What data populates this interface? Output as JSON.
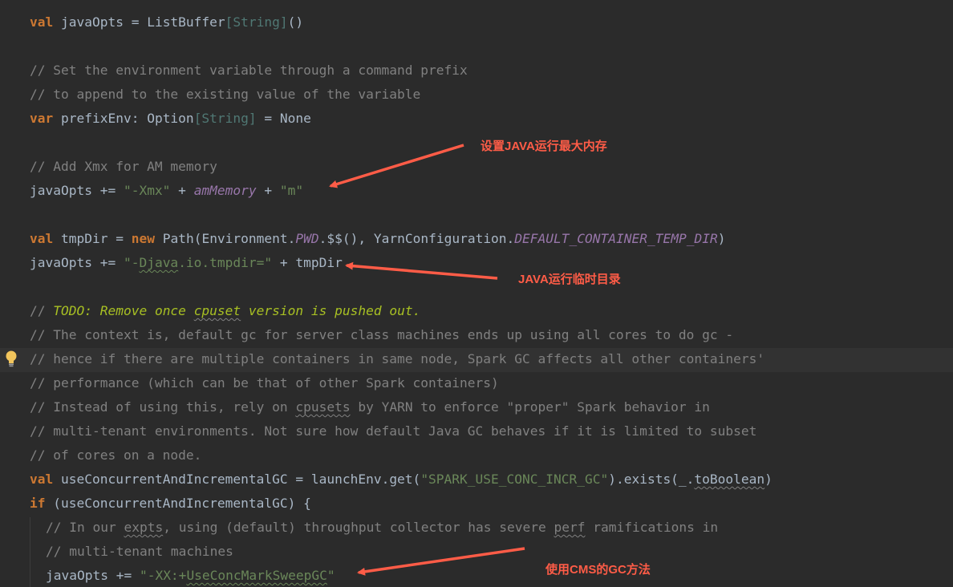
{
  "code_lines": [
    {
      "id": "l1",
      "segments": [
        [
          "kw",
          "val"
        ],
        [
          "txt",
          " javaOpts = ListBuffer"
        ],
        [
          "typ",
          "["
        ],
        [
          "typ",
          "String"
        ],
        [
          "typ",
          "]"
        ],
        [
          "txt",
          "()"
        ]
      ]
    },
    {
      "id": "l2",
      "segments": []
    },
    {
      "id": "l3",
      "segments": [
        [
          "com",
          "// Set the environment variable through a command prefix"
        ]
      ]
    },
    {
      "id": "l4",
      "segments": [
        [
          "com",
          "// to append to the existing value of the variable"
        ]
      ]
    },
    {
      "id": "l5",
      "segments": [
        [
          "kw",
          "var"
        ],
        [
          "txt",
          " prefixEnv: Option"
        ],
        [
          "typ",
          "[String]"
        ],
        [
          "txt",
          " = None"
        ]
      ]
    },
    {
      "id": "l6",
      "segments": []
    },
    {
      "id": "l7",
      "segments": [
        [
          "com",
          "// Add Xmx for AM memory"
        ]
      ]
    },
    {
      "id": "l8",
      "segments": [
        [
          "txt",
          "javaOpts += "
        ],
        [
          "str",
          "\"-Xmx\""
        ],
        [
          "txt",
          " + "
        ],
        [
          "fld",
          "amMemory"
        ],
        [
          "txt",
          " + "
        ],
        [
          "str",
          "\"m\""
        ]
      ]
    },
    {
      "id": "l9",
      "segments": []
    },
    {
      "id": "l10",
      "segments": [
        [
          "kw",
          "val"
        ],
        [
          "txt",
          " tmpDir = "
        ],
        [
          "kw",
          "new"
        ],
        [
          "txt",
          " Path(Environment."
        ],
        [
          "fld",
          "PWD"
        ],
        [
          "txt",
          ".$$(), YarnConfiguration."
        ],
        [
          "fld",
          "DEFAULT_CONTAINER_TEMP_DIR"
        ],
        [
          "txt",
          ")"
        ]
      ]
    },
    {
      "id": "l11",
      "segments": [
        [
          "txt",
          "javaOpts += "
        ],
        [
          "str",
          "\"-"
        ],
        [
          "sq",
          "Djava"
        ],
        [
          "str",
          ".io.tmpdir=\""
        ],
        [
          "txt",
          " + tmpDir"
        ]
      ]
    },
    {
      "id": "l12",
      "segments": []
    },
    {
      "id": "l13",
      "segments": [
        [
          "com",
          "// "
        ],
        [
          "todo",
          "TODO: Remove once "
        ],
        [
          "todo-sq",
          "cpuset"
        ],
        [
          "todo",
          " version is pushed out."
        ]
      ]
    },
    {
      "id": "l14",
      "segments": [
        [
          "com",
          "// The context is, default gc for server class machines ends up using all cores to do gc -"
        ]
      ]
    },
    {
      "id": "l15",
      "segments": [
        [
          "com",
          "// hence if there are multiple containers in same node, Spark GC affects all other containers'"
        ]
      ]
    },
    {
      "id": "l16",
      "segments": [
        [
          "com",
          "// performance (which can be that of other Spark containers)"
        ]
      ]
    },
    {
      "id": "l17",
      "segments": [
        [
          "com",
          "// Instead of using this, rely on "
        ],
        [
          "com-sq",
          "cpusets"
        ],
        [
          "com",
          " by YARN to enforce \"proper\" Spark behavior in"
        ]
      ]
    },
    {
      "id": "l18",
      "segments": [
        [
          "com",
          "// multi-tenant environments. Not sure how default Java GC behaves if it is limited to subset"
        ]
      ]
    },
    {
      "id": "l19",
      "segments": [
        [
          "com",
          "// of cores on a node."
        ]
      ]
    },
    {
      "id": "l20",
      "segments": [
        [
          "kw",
          "val"
        ],
        [
          "txt",
          " useConcurrentAndIncrementalGC = launchEnv.get("
        ],
        [
          "str",
          "\"SPARK_USE_CONC_INCR_GC\""
        ],
        [
          "txt",
          ").exists(_."
        ],
        [
          "txt-sq",
          "toBoolean"
        ],
        [
          "txt",
          ")"
        ]
      ]
    },
    {
      "id": "l21",
      "segments": [
        [
          "kw",
          "if"
        ],
        [
          "txt",
          " (useConcurrentAndIncrementalGC) {"
        ]
      ]
    },
    {
      "id": "l22",
      "indent": true,
      "segments": [
        [
          "com",
          "// In our "
        ],
        [
          "com-sq",
          "expts"
        ],
        [
          "com",
          ", using (default) throughput collector has severe "
        ],
        [
          "com-sq",
          "perf"
        ],
        [
          "com",
          " ramifications in"
        ]
      ]
    },
    {
      "id": "l23",
      "indent": true,
      "segments": [
        [
          "com",
          "// multi-tenant machines"
        ]
      ]
    },
    {
      "id": "l24",
      "indent": true,
      "segments": [
        [
          "txt",
          "javaOpts += "
        ],
        [
          "str",
          "\"-XX:+"
        ],
        [
          "sq",
          "UseConcMarkSweepGC"
        ],
        [
          "str",
          "\""
        ]
      ]
    }
  ],
  "annotations": {
    "max_memory": "设置JAVA运行最大内存",
    "tmp_dir": "JAVA运行临时目录",
    "cms_gc": "使用CMS的GC方法"
  },
  "colors": {
    "background": "#2b2b2b",
    "keyword": "#cc7832",
    "comment": "#808080",
    "string": "#6a8759",
    "annotation_arrow": "#ff5c47"
  },
  "icons": {
    "intention_bulb": "lightbulb-icon"
  }
}
